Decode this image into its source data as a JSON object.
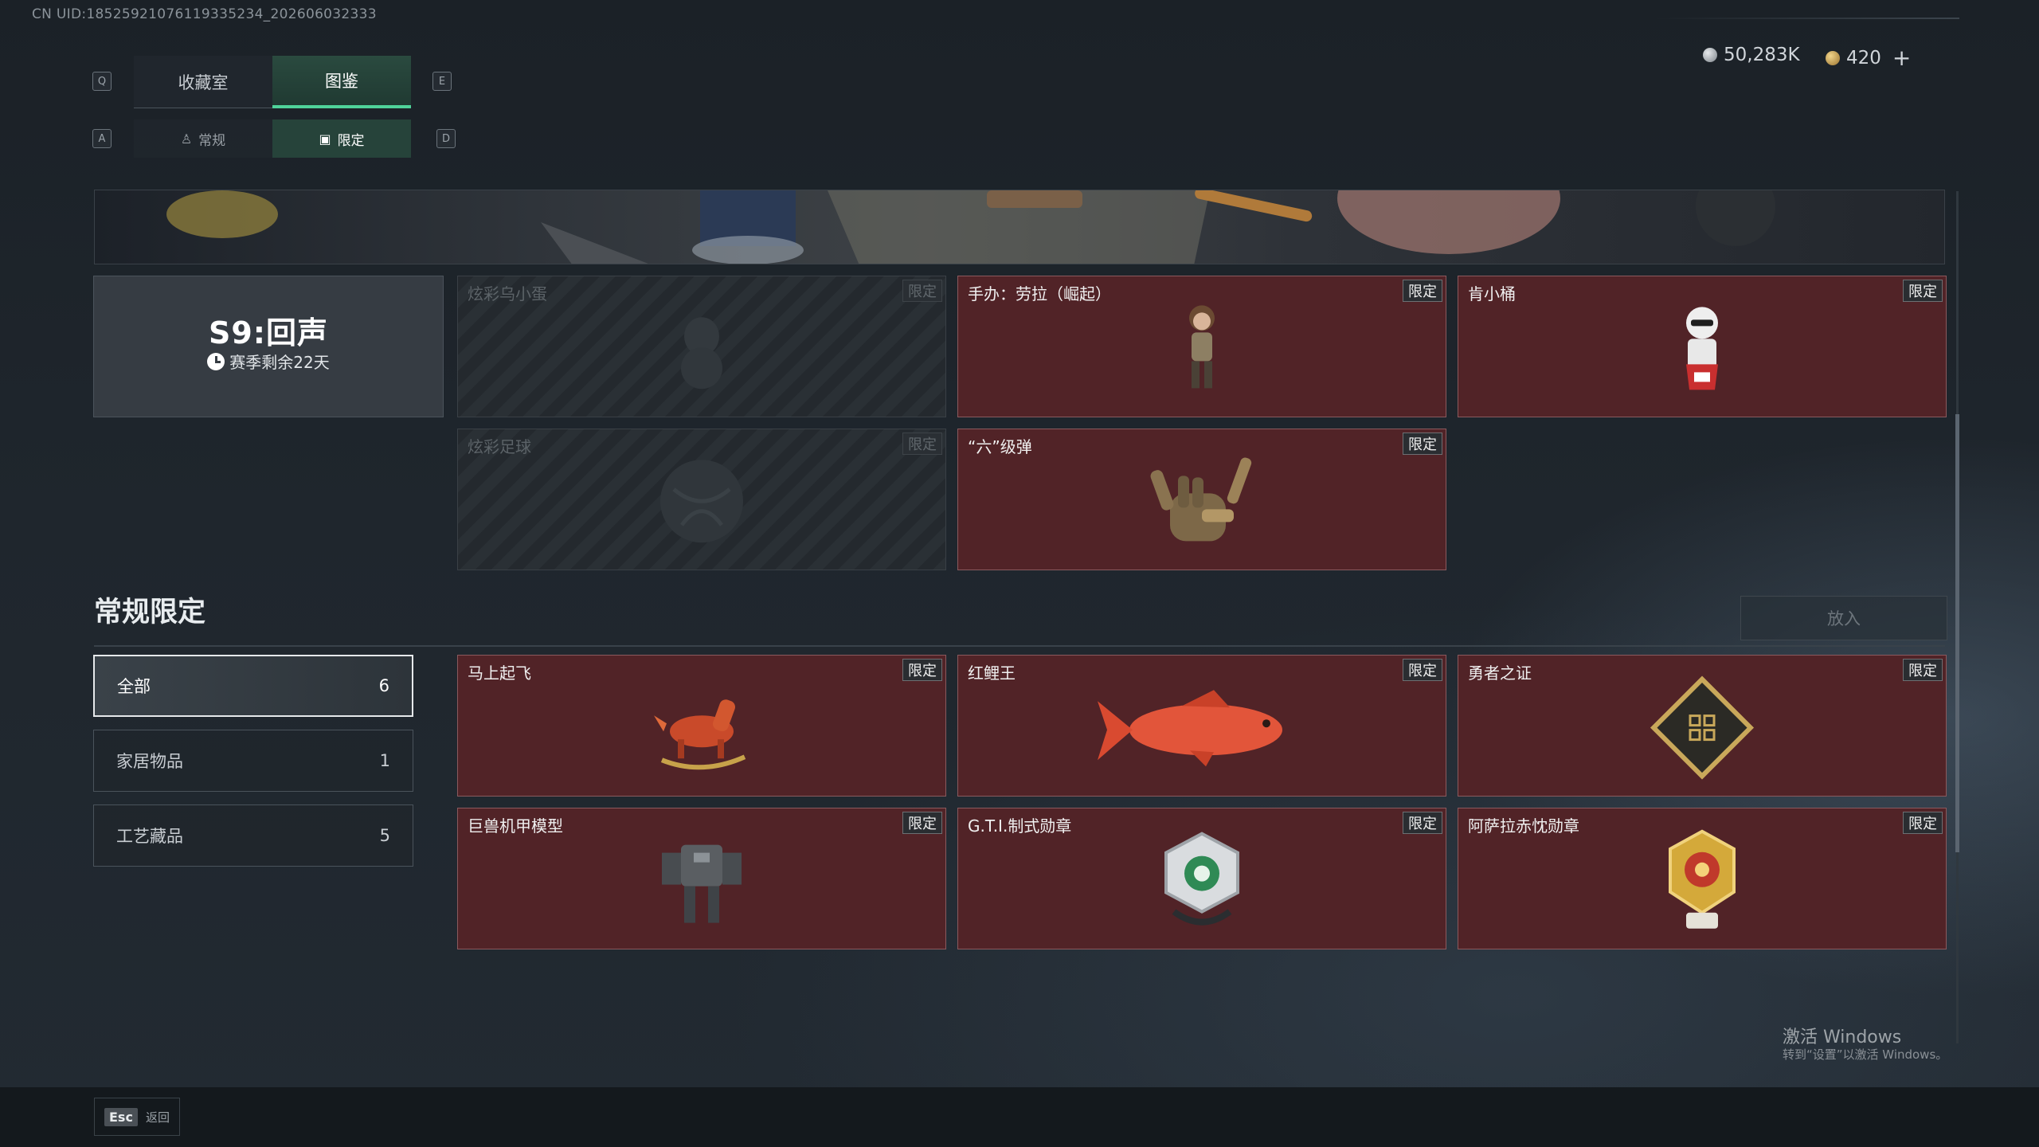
{
  "uid_text": "CN UID:18525921076119335234_202606032333",
  "nav": {
    "q_key": "Q",
    "e_key": "E",
    "a_key": "A",
    "d_key": "D",
    "tabs": [
      {
        "label": "收藏室",
        "active": false
      },
      {
        "label": "图鉴",
        "active": true
      }
    ],
    "subtabs": [
      {
        "label": "常规",
        "active": false
      },
      {
        "label": "限定",
        "active": true
      }
    ]
  },
  "currency": {
    "silver": "50,283K",
    "gold": "420",
    "add_label": "+"
  },
  "season": {
    "title": "S9:回声",
    "remaining": "赛季剩余22天"
  },
  "season_items": [
    {
      "name": "炫彩乌小蛋",
      "badge": "限定",
      "locked": true,
      "icon": "egg-figure-icon"
    },
    {
      "name": "手办：劳拉（崛起）",
      "badge": "限定",
      "locked": false,
      "icon": "lara-figure-icon"
    },
    {
      "name": "肯小桶",
      "badge": "限定",
      "locked": false,
      "icon": "colonel-figure-icon"
    },
    {
      "name": "炫彩足球",
      "badge": "限定",
      "locked": true,
      "icon": "football-icon"
    },
    {
      "name": "“六”级弹",
      "badge": "限定",
      "locked": false,
      "icon": "hand-bullets-icon"
    }
  ],
  "section": {
    "title": "常规限定",
    "place_button": "放入"
  },
  "filters": [
    {
      "label": "全部",
      "count": "6",
      "active": true
    },
    {
      "label": "家居物品",
      "count": "1",
      "active": false
    },
    {
      "label": "工艺藏品",
      "count": "5",
      "active": false
    }
  ],
  "regular_items": [
    {
      "name": "马上起飞",
      "badge": "限定",
      "icon": "rocking-horse-icon"
    },
    {
      "name": "红鲤王",
      "badge": "限定",
      "icon": "carp-icon"
    },
    {
      "name": "勇者之证",
      "badge": "限定",
      "icon": "brave-emblem-icon"
    },
    {
      "name": "巨兽机甲模型",
      "badge": "限定",
      "icon": "mech-model-icon"
    },
    {
      "name": "G.T.I.制式勋章",
      "badge": "限定",
      "icon": "gti-medal-icon"
    },
    {
      "name": "阿萨拉赤忱勋章",
      "badge": "限定",
      "icon": "asara-medal-icon"
    }
  ],
  "footer": {
    "esc_key": "Esc",
    "back_label": "返回"
  },
  "watermark": {
    "line1": "激活 Windows",
    "line2": "转到“设置”以激活 Windows。"
  },
  "colors": {
    "accent_green": "#4fd39a",
    "card_red": "#512327",
    "card_border": "#8a5a5e"
  }
}
